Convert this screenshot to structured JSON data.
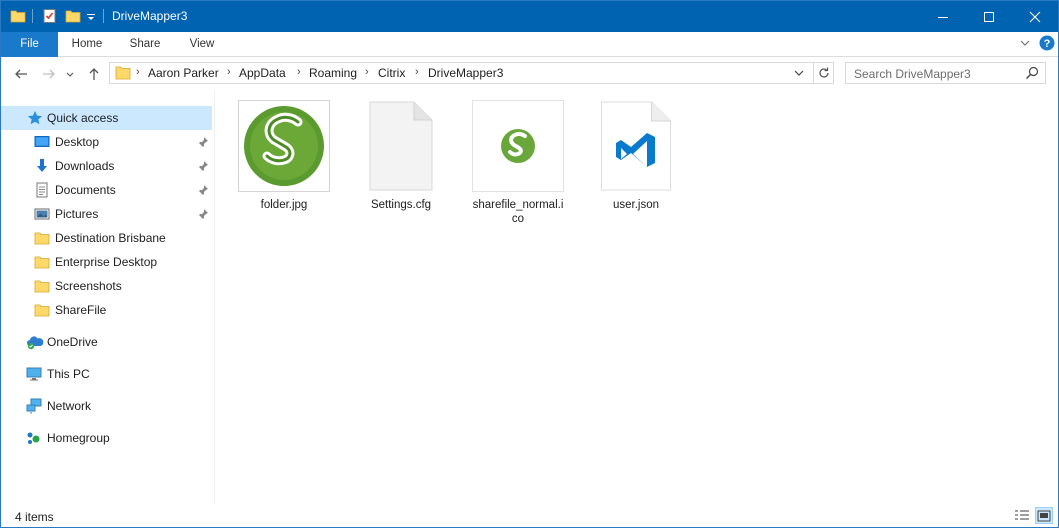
{
  "window": {
    "title": "DriveMapper3"
  },
  "ribbon": {
    "tabs": [
      "File",
      "Home",
      "Share",
      "View"
    ]
  },
  "address": {
    "crumbs": [
      "Aaron Parker",
      "AppData",
      "Roaming",
      "Citrix",
      "DriveMapper3"
    ],
    "search_placeholder": "Search DriveMapper3"
  },
  "sidebar": {
    "quick_access": "Quick access",
    "pinned": [
      {
        "label": "Desktop",
        "icon": "desktop-icon"
      },
      {
        "label": "Downloads",
        "icon": "downloads-icon"
      },
      {
        "label": "Documents",
        "icon": "documents-icon"
      },
      {
        "label": "Pictures",
        "icon": "pictures-icon"
      }
    ],
    "folders": [
      "Destination Brisbane",
      "Enterprise Desktop",
      "Screenshots",
      "ShareFile"
    ],
    "onedrive": "OneDrive",
    "thispc": "This PC",
    "network": "Network",
    "homegroup": "Homegroup"
  },
  "files": [
    {
      "name": "folder.jpg",
      "icon": "sharefile-large-thumbnail"
    },
    {
      "name": "Settings.cfg",
      "icon": "blank-document-icon"
    },
    {
      "name": "sharefile_normal.ico",
      "icon": "sharefile-small-thumbnail"
    },
    {
      "name": "user.json",
      "icon": "vscode-document-icon"
    }
  ],
  "status": {
    "items": "4 items"
  },
  "colors": {
    "titlebar": "#0063b1",
    "file_tab": "#1979ca",
    "selected": "#cce8ff",
    "sharefile_green": "#5a9a2e",
    "vscode_blue": "#0a7acc"
  }
}
